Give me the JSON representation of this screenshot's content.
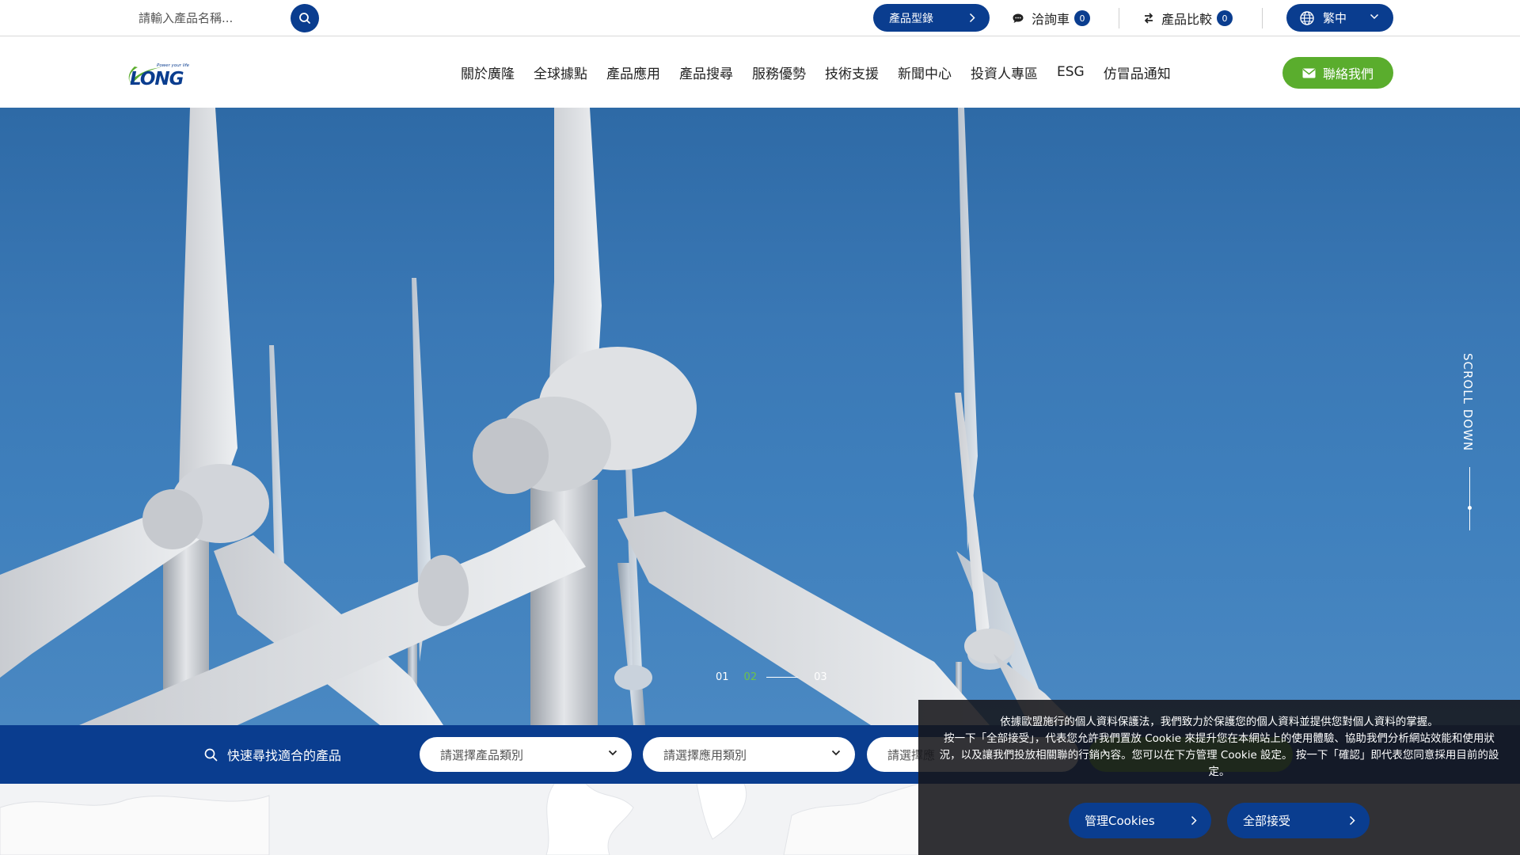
{
  "topbar": {
    "search_placeholder": "請輸入產品名稱...",
    "catalog_label": "產品型錄",
    "inquiry_label": "洽詢車",
    "inquiry_count": "0",
    "compare_label": "產品比較",
    "compare_count": "0",
    "language_label": "繁中"
  },
  "header": {
    "logo_text": "LONG",
    "logo_tagline": "Power your life",
    "nav": [
      "關於廣隆",
      "全球據點",
      "產品應用",
      "產品搜尋",
      "服務優勢",
      "技術支援",
      "新聞中心",
      "投資人專區",
      "ESG",
      "仿冒品通知"
    ],
    "contact_label": "聯絡我們"
  },
  "hero": {
    "scroll_text": "SCROLL DOWN",
    "slides": [
      "01",
      "02",
      "03"
    ],
    "active_slide": "02"
  },
  "quick_search": {
    "label": "快速尋找適合的產品",
    "select_1": "請選擇產品類別",
    "select_2": "請選擇應用類別",
    "select_3": "請選擇應"
  },
  "cookie": {
    "line1": "依據歐盟施行的個人資料保護法，我們致力於保護您的個人資料並提供您對個人資料的掌握。",
    "line2": "按一下「全部接受」，代表您允許我們置放 Cookie 來提升您在本網站上的使用體驗、協助我們分析網站效能和使用狀況，以及讓我們投放相關聯的行銷內容。您可以在下方管理 Cookie 設定。 按一下「確認」即代表您同意採用目前的設定。",
    "manage_label": "管理Cookies",
    "accept_label": "全部接受"
  },
  "colors": {
    "brand_blue": "#0a3d8f",
    "brand_green": "#5aad2d",
    "sky": "#3a78b5"
  }
}
